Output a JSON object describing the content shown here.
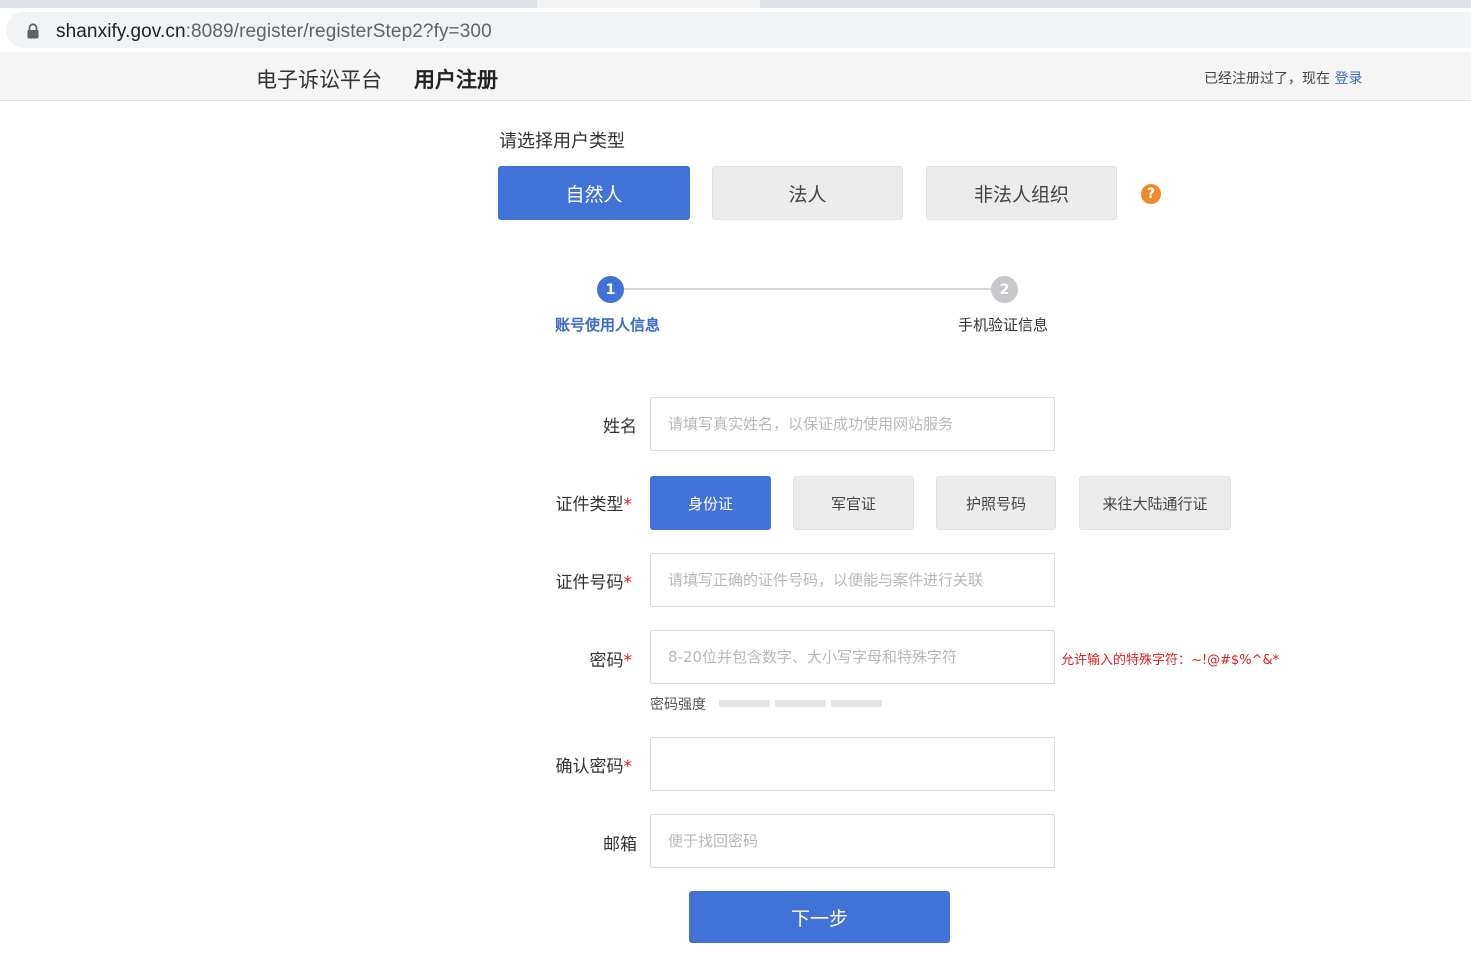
{
  "browser": {
    "url_host": "shanxify.gov.cn",
    "url_rest": ":8089/register/registerStep2?fy=300"
  },
  "header": {
    "platform_name": "电子诉讼平台",
    "page_heading": "用户注册",
    "login_prompt": "已经注册过了，现在 ",
    "login_link": "登录"
  },
  "user_type": {
    "label": "请选择用户类型",
    "options": [
      "自然人",
      "法人",
      "非法人组织"
    ],
    "selected": "自然人",
    "help_glyph": "?"
  },
  "steps": [
    {
      "number": "1",
      "label": "账号使用人信息",
      "status": "active"
    },
    {
      "number": "2",
      "label": "手机验证信息",
      "status": "pending"
    }
  ],
  "form": {
    "name": {
      "label": "姓名",
      "placeholder": "请填写真实姓名，以保证成功使用网站服务",
      "value": ""
    },
    "id_type": {
      "label": "证件类型",
      "options": [
        "身份证",
        "军官证",
        "护照号码",
        "来往大陆通行证"
      ],
      "selected": "身份证"
    },
    "id_number": {
      "label": "证件号码",
      "placeholder": "请填写正确的证件号码，以便能与案件进行关联",
      "value": ""
    },
    "password": {
      "label": "密码",
      "placeholder": "8-20位并包含数字、大小写字母和特殊字符",
      "value": "",
      "hint": "允许输入的特殊字符：~!@#$%^&*",
      "strength_label": "密码强度"
    },
    "confirm_password": {
      "label": "确认密码",
      "placeholder": "",
      "value": ""
    },
    "email": {
      "label": "邮箱",
      "placeholder": "便于找回密码",
      "value": ""
    },
    "required_mark": "*",
    "next_button": "下一步"
  },
  "colors": {
    "primary": "#4172d8",
    "required": "#e02020",
    "help": "#ee8a2c"
  }
}
